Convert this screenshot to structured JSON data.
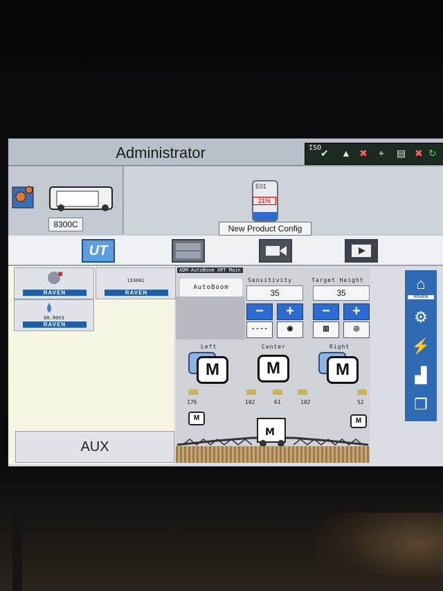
{
  "header": {
    "title": "Administrator",
    "status_label": "ISO"
  },
  "machine_tile": {
    "label": "8300C"
  },
  "product_tile": {
    "tank_code": "E01",
    "tank_fill_percent_text": "21%",
    "tank_fill": 0.21,
    "label": "New Product Config"
  },
  "tabs": [
    {
      "label": "UT"
    },
    {
      "label": ""
    },
    {
      "label": ""
    },
    {
      "label": ""
    }
  ],
  "left_panel": {
    "ecus": [
      {
        "brand": "RAVEN"
      },
      {
        "brand": "RAVEN",
        "code": "133001"
      },
      {
        "brand": "RAVEN",
        "code": "60.90X3"
      }
    ],
    "aux_label": "AUX"
  },
  "ut_screen": {
    "title": "ADM-AutoBoom XRT Main",
    "mode_label": "AutoBoom",
    "sensitivity": {
      "label": "Sensitivity",
      "value": "35"
    },
    "target_height": {
      "label": "Target Height",
      "value": "35"
    },
    "sections": {
      "left": "Left",
      "center": "Center",
      "right": "Right"
    },
    "mode_letter": "M",
    "heights": [
      "176",
      "102",
      "61",
      "102",
      "52"
    ]
  },
  "right_bar": {
    "brand": "RAVEN"
  },
  "colors": {
    "accent_blue": "#2e6bd0",
    "raven_blue": "#1f5fa6",
    "tank_fill": "#2e6bd0"
  }
}
